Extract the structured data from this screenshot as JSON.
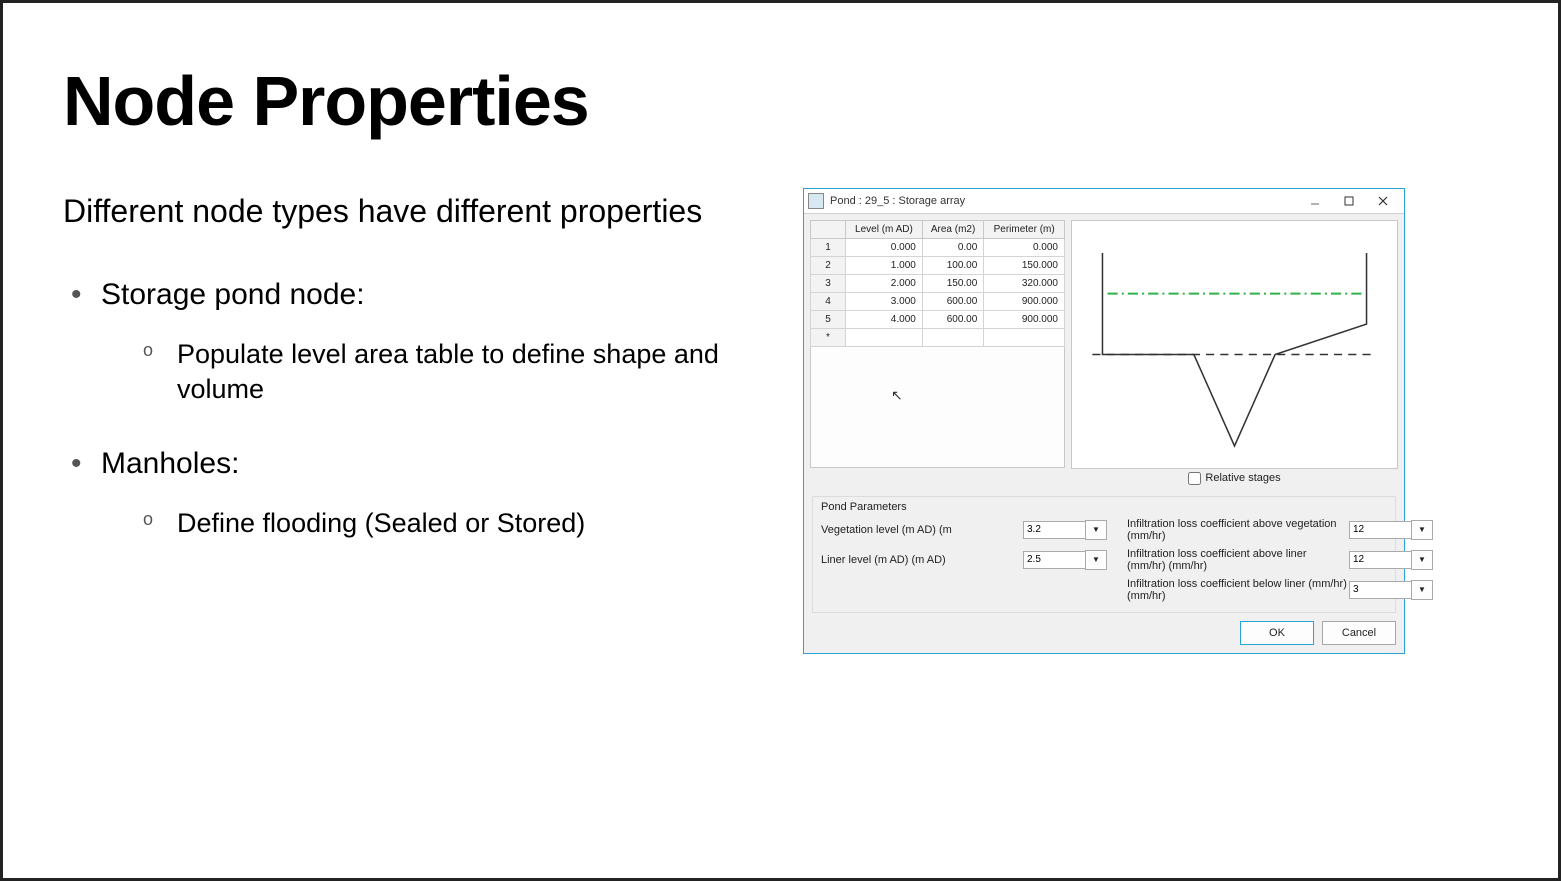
{
  "slide": {
    "title": "Node Properties",
    "intro": "Different node types have different properties",
    "bullet1": "Storage pond node:",
    "sub1": "Populate level area table to define shape and volume",
    "bullet2": "Manholes:",
    "sub2": "Define flooding (Sealed or Stored)"
  },
  "dialog": {
    "title": "Pond : 29_5 : Storage array",
    "columns": {
      "c1": "Level (m AD)",
      "c2": "Area (m2)",
      "c3": "Perimeter (m)"
    },
    "rows": [
      {
        "n": "1",
        "level": "0.000",
        "area": "0.00",
        "perim": "0.000"
      },
      {
        "n": "2",
        "level": "1.000",
        "area": "100.00",
        "perim": "150.000"
      },
      {
        "n": "3",
        "level": "2.000",
        "area": "150.00",
        "perim": "320.000"
      },
      {
        "n": "4",
        "level": "3.000",
        "area": "600.00",
        "perim": "900.000"
      },
      {
        "n": "5",
        "level": "4.000",
        "area": "600.00",
        "perim": "900.000"
      }
    ],
    "new_row_marker": "*",
    "relative_stages_label": "Relative stages",
    "params_title": "Pond Parameters",
    "params": {
      "veg_label": "Vegetation level (m AD) (m",
      "veg_value": "3.2",
      "liner_label": "Liner level (m AD) (m AD)",
      "liner_value": "2.5",
      "il_above_veg_label": "Infiltration loss coefficient above vegetation (mm/hr)",
      "il_above_veg_value": "12",
      "il_above_liner_label": "Infiltration loss coefficient above liner (mm/hr) (mm/hr)",
      "il_above_liner_value": "12",
      "il_below_liner_label": "Infiltration loss coefficient below liner (mm/hr) (mm/hr)",
      "il_below_liner_value": "3"
    },
    "buttons": {
      "ok": "OK",
      "cancel": "Cancel"
    }
  }
}
